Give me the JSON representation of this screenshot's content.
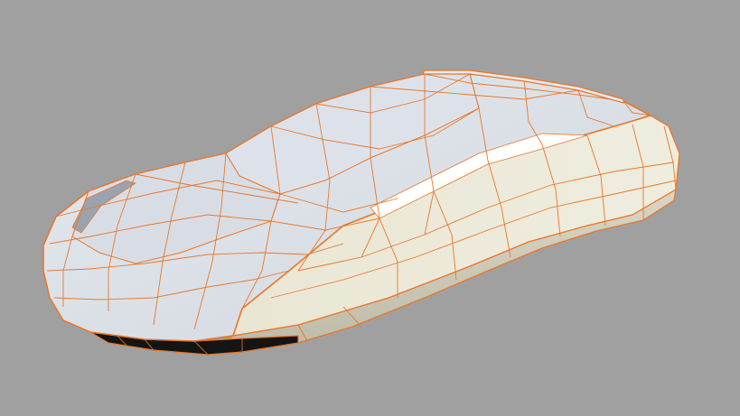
{
  "viewport": {
    "background_color": "#a0a0a0",
    "model": {
      "name": "car-body-mesh",
      "shading": "flat",
      "wireframe_color": "#e8782a",
      "selection_outline_color": "#e8782a",
      "surface_light": "#e6e9ee",
      "surface_mid": "#cdd3dc",
      "surface_warm": "#ede9d6",
      "underside_color": "#141414"
    }
  }
}
